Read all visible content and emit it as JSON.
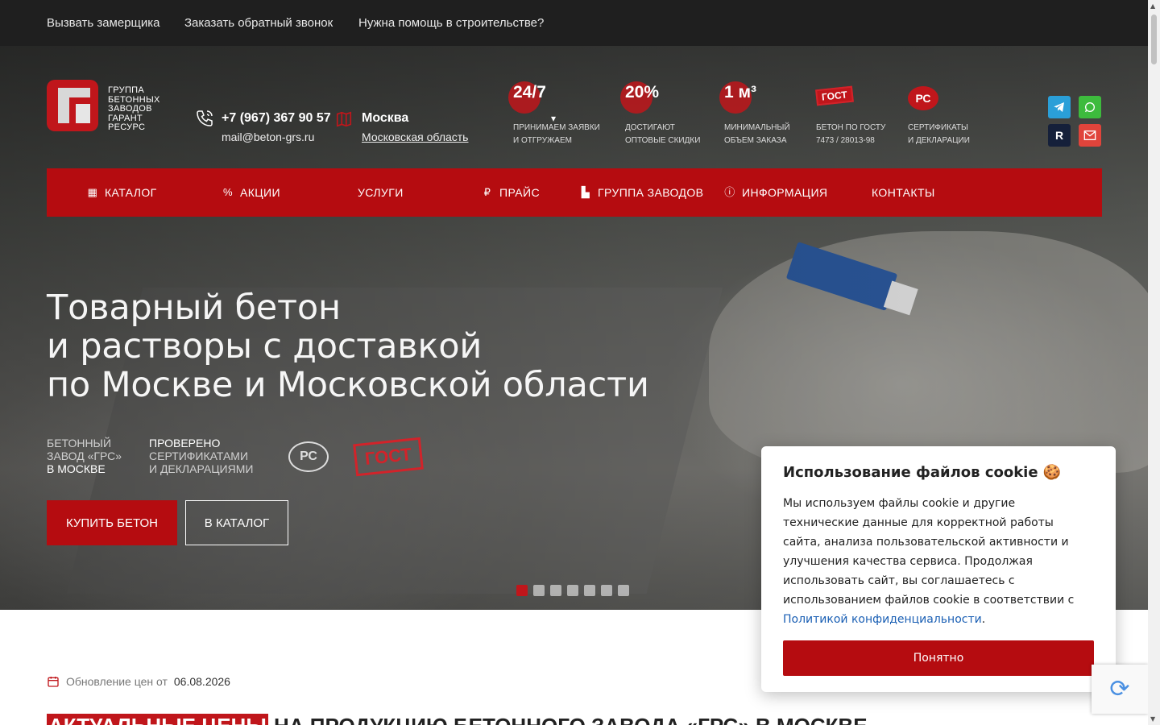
{
  "topbar": {
    "links": [
      "Вызвать замерщика",
      "Заказать обратный звонок",
      "Нужна помощь в строительстве?"
    ]
  },
  "logo": {
    "lines": [
      "ГРУППА",
      "БЕТОННЫХ",
      "ЗАВОДОВ",
      "ГАРАНТ",
      "РЕСУРС"
    ]
  },
  "contacts": {
    "phone": "+7 (967) 367 90 57",
    "email": "mail@beton-grs.ru",
    "city": "Москва",
    "region": "Московская область"
  },
  "features": [
    {
      "big": "24/7",
      "small1": "ПРИНИМАЕМ ЗАЯВКИ",
      "small2": "И ОТГРУЖАЕМ"
    },
    {
      "big": "20%",
      "small1": "ДОСТИГАЮТ",
      "small2": "ОПТОВЫЕ СКИДКИ"
    },
    {
      "big": "1 м³",
      "small1": "МИНИМАЛЬНЫЙ",
      "small2": "ОБЪЕМ ЗАКАЗА"
    },
    {
      "stamp": "ГОСТ",
      "small1": "БЕТОН ПО ГОСТУ",
      "small2": "7473 / 28013-98"
    },
    {
      "stamp": "РС",
      "small1": "СЕРТИФИКАТЫ",
      "small2": "И ДЕКЛАРАЦИИ"
    }
  ],
  "social": {
    "telegram_color": "#2a9fd8",
    "whatsapp_color": "#3dbb3d",
    "rutube_color": "#15203a",
    "rutube_label": "R",
    "mail_color": "#e0443b"
  },
  "nav": {
    "items": [
      "КАТАЛОГ",
      "АКЦИИ",
      "УСЛУГИ",
      "ПРАЙС",
      "ГРУППА ЗАВОДОВ",
      "ИНФОРМАЦИЯ",
      "КОНТАКТЫ"
    ]
  },
  "hero": {
    "title_lines": [
      "Товарный бетон",
      "и растворы с доставкой",
      "по Москве и Московской области"
    ],
    "badge1": [
      "БЕТОННЫЙ",
      "ЗАВОД «ГРС»",
      "В МОСКВЕ"
    ],
    "badge2": [
      "ПРОВЕРЕНО",
      "СЕРТИФИКАТАМИ",
      "И ДЕКЛАРАЦИЯМИ"
    ],
    "rst_mark": "РС",
    "gost_mark": "ГОСТ",
    "buy_button": "КУПИТЬ БЕТОН",
    "catalog_button": "В КАТАЛОГ",
    "slides_total": 7,
    "active_slide": 1
  },
  "prices": {
    "update_label": "Обновление цен от",
    "update_date": "06.08.2026",
    "section_title_highlight": "АКТУАЛЬНЫЕ ЦЕНЫ",
    "section_title_rest": " НА ПРОДУКЦИЮ БЕТОННОГО ЗАВОДА «ГРС» В МОСКВЕ"
  },
  "cookie": {
    "title": "Использование файлов cookie 🍪",
    "text": "Мы используем файлы cookie и другие технические данные для корректной работы сайта, анализа пользовательской активности и улучшения качества сервиса. Продолжая использовать сайт, вы соглашаетесь с использованием файлов cookie в соответствии с",
    "link": "Политикой конфиденциальности",
    "after_link": ".",
    "button": "Понятно"
  },
  "colors": {
    "brand_red": "#b50c10",
    "topbar": "#1f1f1f"
  }
}
